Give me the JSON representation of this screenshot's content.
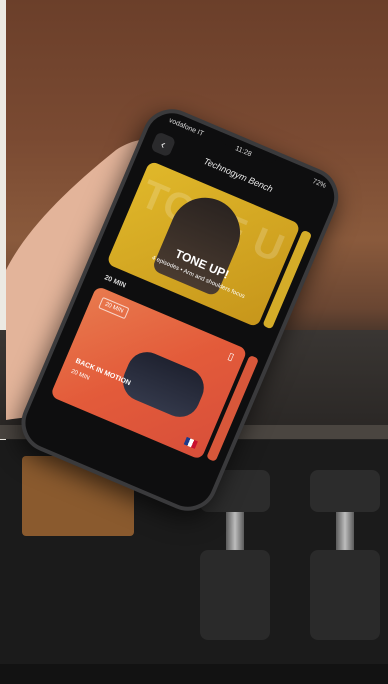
{
  "status_bar": {
    "carrier": "vodafone IT",
    "time": "11:28",
    "battery": "72%"
  },
  "nav": {
    "back_glyph": "‹",
    "title": "Technogym Bench"
  },
  "hero": {
    "background_text": "TONE U",
    "title": "TONE UP!",
    "subtitle": "4 episodes • Arm and shoulders focus"
  },
  "section": {
    "label": "20 MIN"
  },
  "card": {
    "tag": "20 MIN",
    "title": "BACK IN MOTION",
    "meta": "20 MIN",
    "bookmark_glyph": "▯"
  },
  "colors": {
    "hero_yellow": "#e0b82a",
    "card_orange": "#e35b3a",
    "phone_body": "#0e0e0f"
  }
}
